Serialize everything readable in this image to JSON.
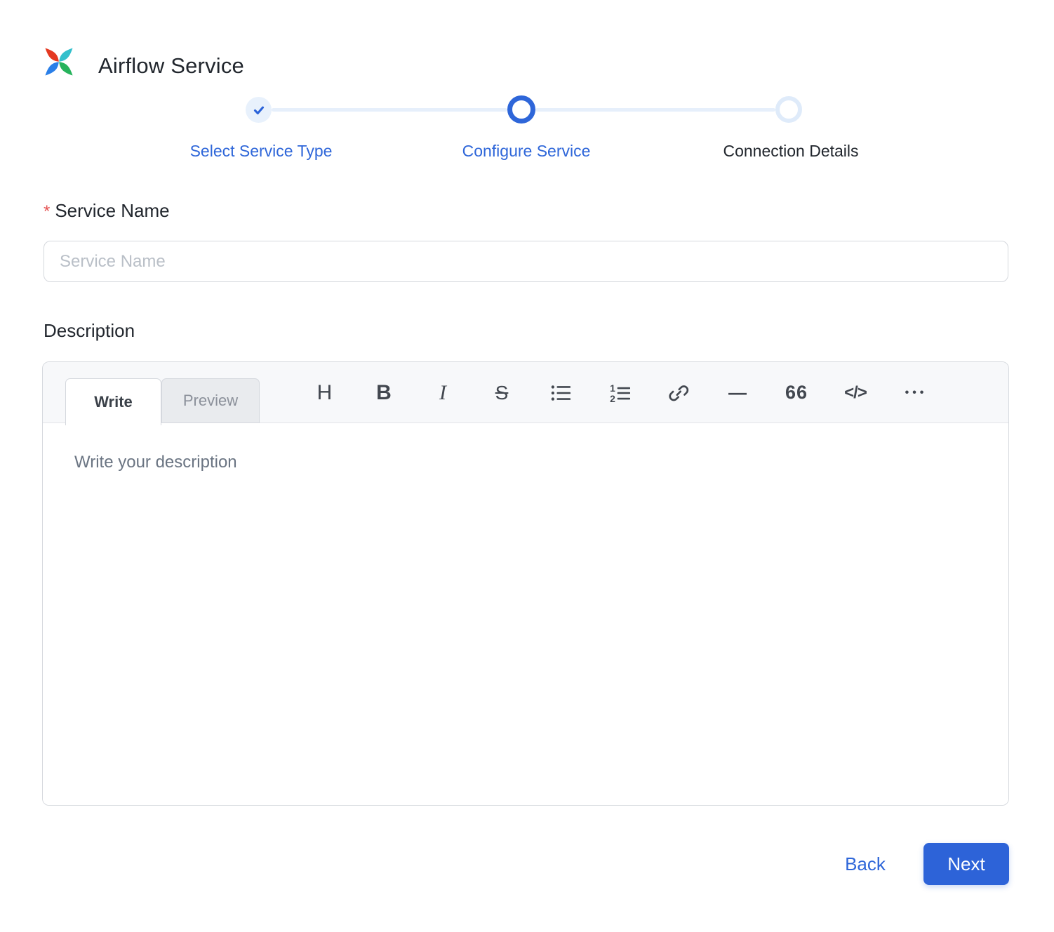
{
  "header": {
    "title": "Airflow Service",
    "logo": "airflow-pinwheel"
  },
  "stepper": {
    "steps": [
      {
        "label": "Select Service Type",
        "state": "completed"
      },
      {
        "label": "Configure Service",
        "state": "active"
      },
      {
        "label": "Connection Details",
        "state": "upcoming"
      }
    ]
  },
  "form": {
    "required_marker": "*",
    "service_name": {
      "label": "Service Name",
      "placeholder": "Service Name",
      "value": ""
    },
    "description": {
      "label": "Description"
    }
  },
  "editor": {
    "tabs": {
      "write": "Write",
      "preview": "Preview"
    },
    "active_tab": "Write",
    "toolbar": [
      {
        "name": "heading",
        "glyph": "H"
      },
      {
        "name": "bold",
        "glyph": "B"
      },
      {
        "name": "italic",
        "glyph": "I"
      },
      {
        "name": "strikethrough",
        "glyph": "S"
      },
      {
        "name": "bullet-list",
        "glyph": ""
      },
      {
        "name": "numbered-list",
        "glyph": ""
      },
      {
        "name": "link",
        "glyph": ""
      },
      {
        "name": "horizontal-rule",
        "glyph": "—"
      },
      {
        "name": "quote",
        "glyph": "66"
      },
      {
        "name": "code",
        "glyph": "</>"
      },
      {
        "name": "more",
        "glyph": "•••"
      }
    ],
    "placeholder": "Write your description",
    "value": ""
  },
  "footer": {
    "back_label": "Back",
    "next_label": "Next"
  },
  "colors": {
    "primary": "#2E66D9",
    "primary_light_bg": "#E8F1FC",
    "connector": "#E6EFFB",
    "required": "#E55353",
    "icon": "#42474F"
  }
}
